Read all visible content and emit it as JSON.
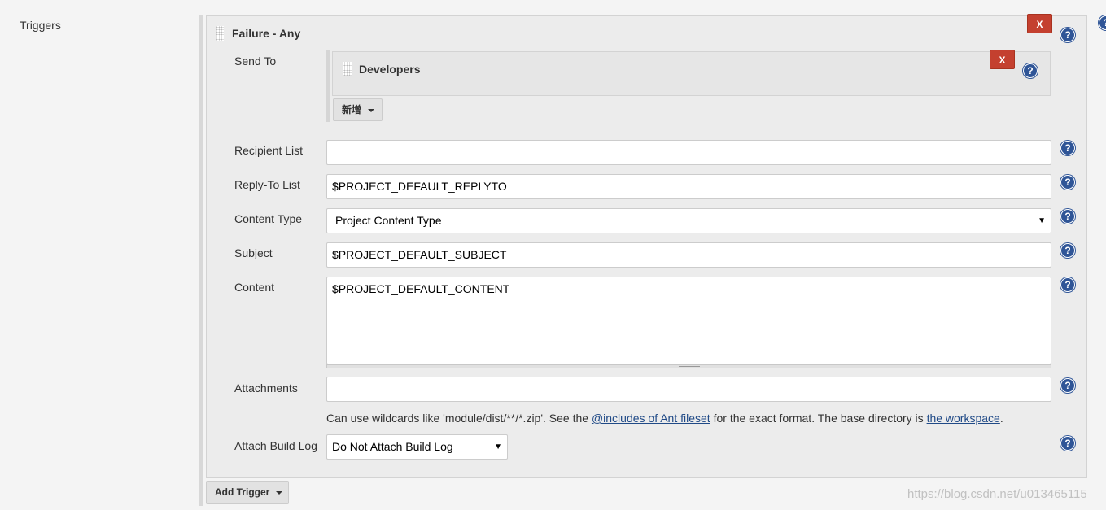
{
  "section_label": "Triggers",
  "trigger": {
    "title": "Failure - Any",
    "delete_label": "X",
    "send_to": {
      "label": "Send To",
      "recipient": "Developers",
      "delete_label": "X",
      "add_label": "新增"
    },
    "fields": {
      "recipient_list": {
        "label": "Recipient List",
        "value": ""
      },
      "reply_to": {
        "label": "Reply-To List",
        "value": "$PROJECT_DEFAULT_REPLYTO"
      },
      "content_type": {
        "label": "Content Type",
        "value": "Project Content Type"
      },
      "subject": {
        "label": "Subject",
        "value": "$PROJECT_DEFAULT_SUBJECT"
      },
      "content": {
        "label": "Content",
        "value": "$PROJECT_DEFAULT_CONTENT"
      },
      "attachments": {
        "label": "Attachments",
        "value": ""
      },
      "attach_build_log": {
        "label": "Attach Build Log",
        "value": "Do Not Attach Build Log"
      }
    },
    "attachments_help": {
      "before": "Can use wildcards like 'module/dist/**/*.zip'. See the ",
      "link1": "@includes of Ant fileset",
      "middle": " for the exact format. The base directory is ",
      "link2": "the workspace",
      "after": "."
    }
  },
  "add_trigger_label": "Add Trigger",
  "help_glyph": "?",
  "watermark": "https://blog.csdn.net/u013465115",
  "colors": {
    "delete": "#c4402f",
    "help": "#2f5597",
    "link": "#204a87"
  }
}
